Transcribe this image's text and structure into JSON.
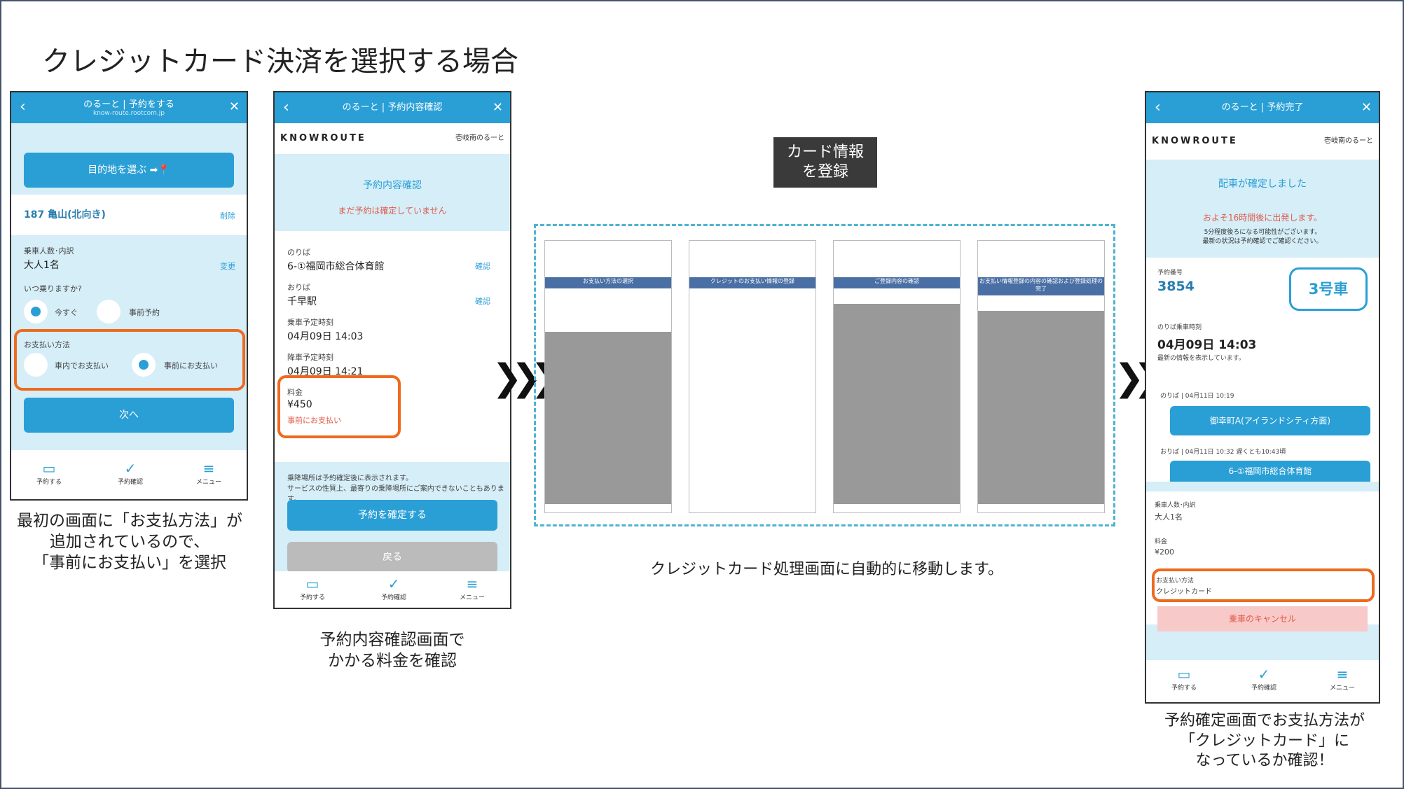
{
  "title": "クレジットカード決済を選択する場合",
  "phone1": {
    "header": "のるーと | 予約をする",
    "url": "know-route.rootcom.jp",
    "dest_btn": "目的地を選ぶ",
    "stop": "187 亀山(北向き)",
    "delete": "削除",
    "pax_label": "乗車人数･内訳",
    "pax": "大人1名",
    "change": "変更",
    "when": "いつ乗りますか?",
    "now": "今すぐ",
    "reserve": "事前予約",
    "pay_label": "お支払い方法",
    "pay_car": "車内でお支払い",
    "pay_pre": "事前にお支払い",
    "next": "次へ",
    "tab1": "予約する",
    "tab2": "予約確認",
    "tab3": "メニュー"
  },
  "cap1": "最初の画面に「お支払方法」が\n追加されているので、\n「事前にお支払い」を選択",
  "phone2": {
    "header": "のるーと | 予約内容確認",
    "brand": "KNOWROUTE",
    "area": "壱岐南のるーと",
    "heading": "予約内容確認",
    "warn": "まだ予約は確定していません",
    "from_label": "のりば",
    "from": "6-①福岡市総合体育館",
    "confirm": "確認",
    "to_label": "おりば",
    "to": "千早駅",
    "dep_label": "乗車予定時刻",
    "dep": "04月09日 14:03",
    "arr_label": "降車予定時刻",
    "arr": "04月09日 14:21",
    "fare_label": "料金",
    "fare": "¥450",
    "fare_note": "事前にお支払い",
    "note": "乗降場所は予約確定後に表示されます。\nサービスの性質上、最寄りの乗降場所にご案内できないこともあります。",
    "submit": "予約を確定する",
    "back": "戻る"
  },
  "cap2": "予約内容確認画面で\nかかる料金を確認",
  "card_label": "カード情報\nを登録",
  "cap3": "クレジットカード処理画面に自動的に移動します。",
  "minis": [
    "お支払い方法の選択",
    "クレジットのお支払い情報の登録",
    "ご登録内容の確認",
    "お支払い情報登録の内容の確認および登録処理の完了"
  ],
  "phone3": {
    "header": "のるーと | 予約完了",
    "heading": "配車が確定しました",
    "eta": "およそ16時間後に出発します。",
    "eta_note": "5分程度後ろになる可能性がございます。\n最新の状況は予約確認でご確認ください。",
    "no_label": "予約番号",
    "no": "3854",
    "car": "3号車",
    "dep_label": "のりば乗車時刻",
    "dep": "04月09日 14:03",
    "latest": "最新の情報を表示しています。",
    "from_meta": "のりば | 04月11日 10:19",
    "from": "御幸町A(アイランドシティ方面)",
    "to_meta": "おりば | 04月11日 10:32 遅くとも10:43頃",
    "to": "6-①福岡市総合体育館",
    "pax_label": "乗車人数･内訳",
    "pax": "大人1名",
    "fare_label": "料金",
    "fare": "¥200",
    "pay_label": "お支払い方法",
    "pay": "クレジットカード",
    "cancel": "乗車のキャンセル"
  },
  "cap4": "予約確定画面でお支払方法が\n「クレジットカード」に\nなっているか確認！"
}
